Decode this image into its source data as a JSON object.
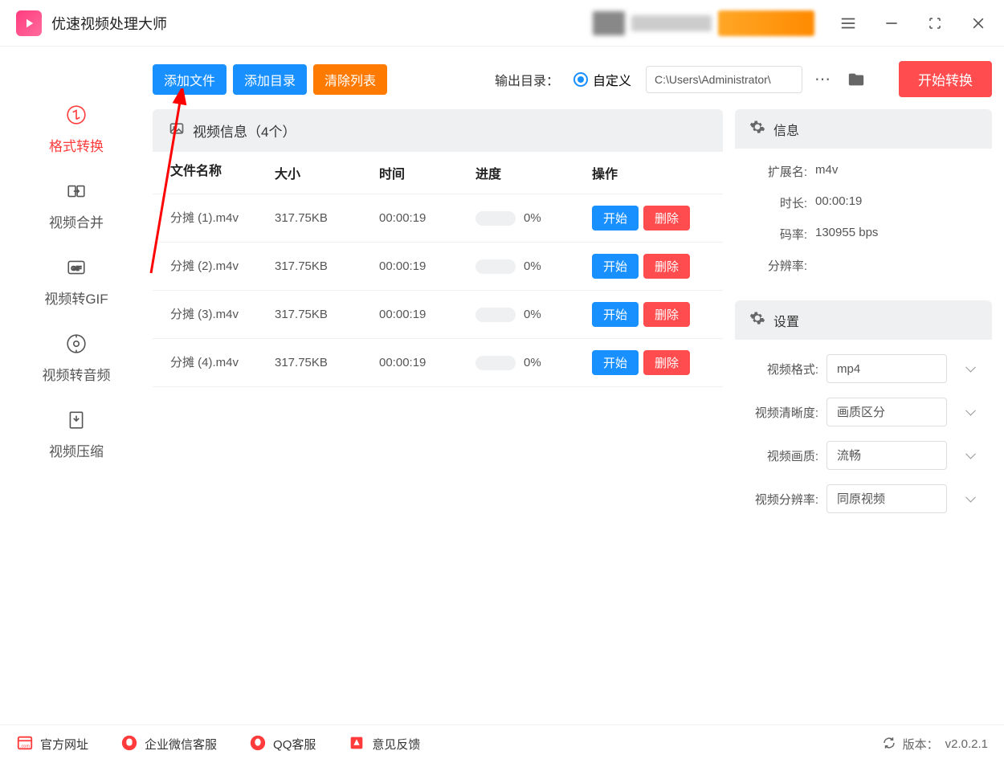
{
  "app": {
    "title": "优速视频处理大师"
  },
  "sidebar": {
    "items": [
      {
        "label": "格式转换"
      },
      {
        "label": "视频合并"
      },
      {
        "label": "视频转GIF"
      },
      {
        "label": "视频转音频"
      },
      {
        "label": "视频压缩"
      }
    ]
  },
  "toolbar": {
    "add_file": "添加文件",
    "add_dir": "添加目录",
    "clear_list": "清除列表",
    "output_label": "输出目录：",
    "custom_label": "自定义",
    "path_value": "C:\\Users\\Administrator\\",
    "start_convert": "开始转换"
  },
  "video_info_bar": "视频信息（4个）",
  "table": {
    "headers": {
      "name": "文件名称",
      "size": "大小",
      "time": "时间",
      "progress": "进度",
      "action": "操作"
    },
    "rows": [
      {
        "name": "分摊 (1).m4v",
        "size": "317.75KB",
        "time": "00:00:19",
        "progress": "0%"
      },
      {
        "name": "分摊 (2).m4v",
        "size": "317.75KB",
        "time": "00:00:19",
        "progress": "0%"
      },
      {
        "name": "分摊 (3).m4v",
        "size": "317.75KB",
        "time": "00:00:19",
        "progress": "0%"
      },
      {
        "name": "分摊 (4).m4v",
        "size": "317.75KB",
        "time": "00:00:19",
        "progress": "0%"
      }
    ],
    "start_btn": "开始",
    "delete_btn": "删除"
  },
  "info_panel": {
    "title": "信息",
    "ext_k": "扩展名:",
    "ext_v": "m4v",
    "dur_k": "时长:",
    "dur_v": "00:00:19",
    "bitrate_k": "码率:",
    "bitrate_v": "130955 bps",
    "res_k": "分辨率:",
    "res_v": ""
  },
  "settings_panel": {
    "title": "设置",
    "format_k": "视频格式:",
    "format_v": "mp4",
    "clarity_k": "视频清晰度:",
    "clarity_v": "画质区分",
    "quality_k": "视频画质:",
    "quality_v": "流畅",
    "res_k": "视频分辨率:",
    "res_v": "同原视频"
  },
  "footer": {
    "official": "官方网址",
    "wechat": "企业微信客服",
    "qq": "QQ客服",
    "feedback": "意见反馈",
    "version_label": "版本：",
    "version": "v2.0.2.1"
  }
}
